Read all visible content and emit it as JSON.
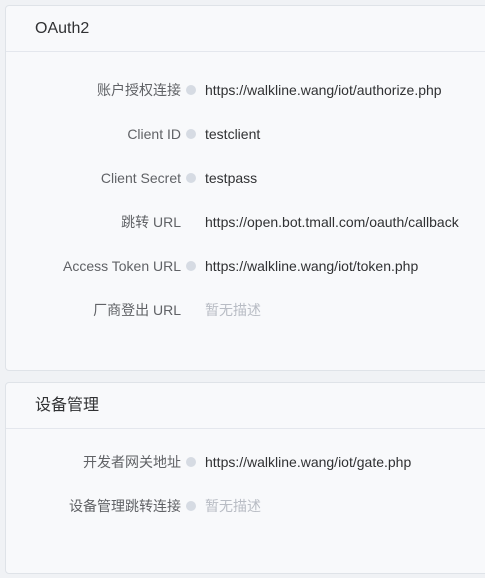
{
  "oauth": {
    "title": "OAuth2",
    "rows": [
      {
        "label": "账户授权连接",
        "value": "https://walkline.wang/iot/authorize.php",
        "has_dot": true
      },
      {
        "label": "Client ID",
        "value": "testclient",
        "has_dot": true
      },
      {
        "label": "Client Secret",
        "value": "testpass",
        "has_dot": true
      },
      {
        "label": "跳转 URL",
        "value": "https://open.bot.tmall.com/oauth/callback",
        "has_dot": false
      },
      {
        "label": "Access Token URL",
        "value": "https://walkline.wang/iot/token.php",
        "has_dot": true
      },
      {
        "label": "厂商登出 URL",
        "value": "暂无描述",
        "has_dot": false
      }
    ]
  },
  "device": {
    "title": "设备管理",
    "rows": [
      {
        "label": "开发者网关地址",
        "value": "https://walkline.wang/iot/gate.php",
        "has_dot": true
      },
      {
        "label": "设备管理跳转连接",
        "value": "暂无描述",
        "has_dot": true
      }
    ]
  },
  "colors": {
    "label": "#606266",
    "value": "#303133",
    "placeholder": "#b8bcc4",
    "dot": "#d6dbe3"
  }
}
